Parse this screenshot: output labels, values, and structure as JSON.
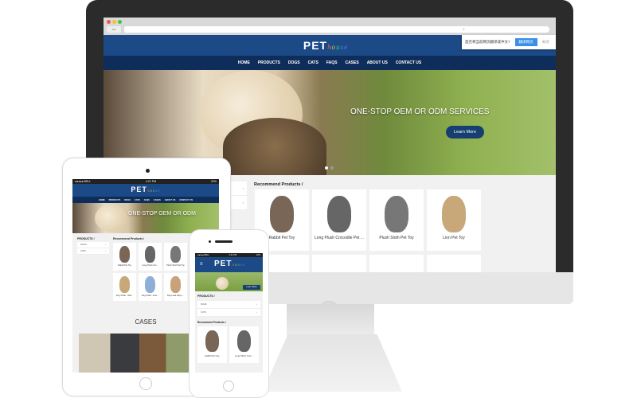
{
  "browser": {
    "translate_prompt": "是否将当前网页翻译成中文?",
    "translate_button": "翻译网页",
    "close_label": "关闭"
  },
  "site": {
    "logo_main": "PET",
    "logo_script": "house",
    "nav": [
      "HOME",
      "PRODUCTS",
      "DOGS",
      "CATS",
      "FAQS",
      "CASES",
      "ABOUT US",
      "CONTACT US"
    ],
    "hero_title": "ONE-STOP OEM OR ODM SERVICES",
    "hero_title_short": "ONE-STOP OEM OR ODM",
    "learn_more": "Learn More",
    "products_heading": "PRODUCTS /",
    "categories": [
      "DOGS",
      "CATS"
    ],
    "recommend_heading": "Recommend Products /",
    "desktop_products": [
      "Rabbit Pet Toy",
      "Long Plush Crocodile Pet ...",
      "Plush Sloth Pet Toy",
      "Lion Pet Toy"
    ],
    "tablet_products": [
      "Rabbit Pet Toy",
      "Long Plush Cro...",
      "Plush Sloth Pet Toy",
      "Dog Collar - Wat...",
      "Dog Collar - Ena...",
      "Dog Lead Rope ..."
    ],
    "phone_products": [
      "Rabbit Pet Toy",
      "Long Plush Croc..."
    ],
    "cases_heading": "CASES"
  },
  "status": {
    "carrier": "●●●●● BELL",
    "time": "4:21 PM",
    "battery": "22%"
  },
  "colors": {
    "header": "#1b4a87",
    "nav": "#0f2d5a",
    "button": "#163e72",
    "popup_button": "#3b8fe6"
  }
}
